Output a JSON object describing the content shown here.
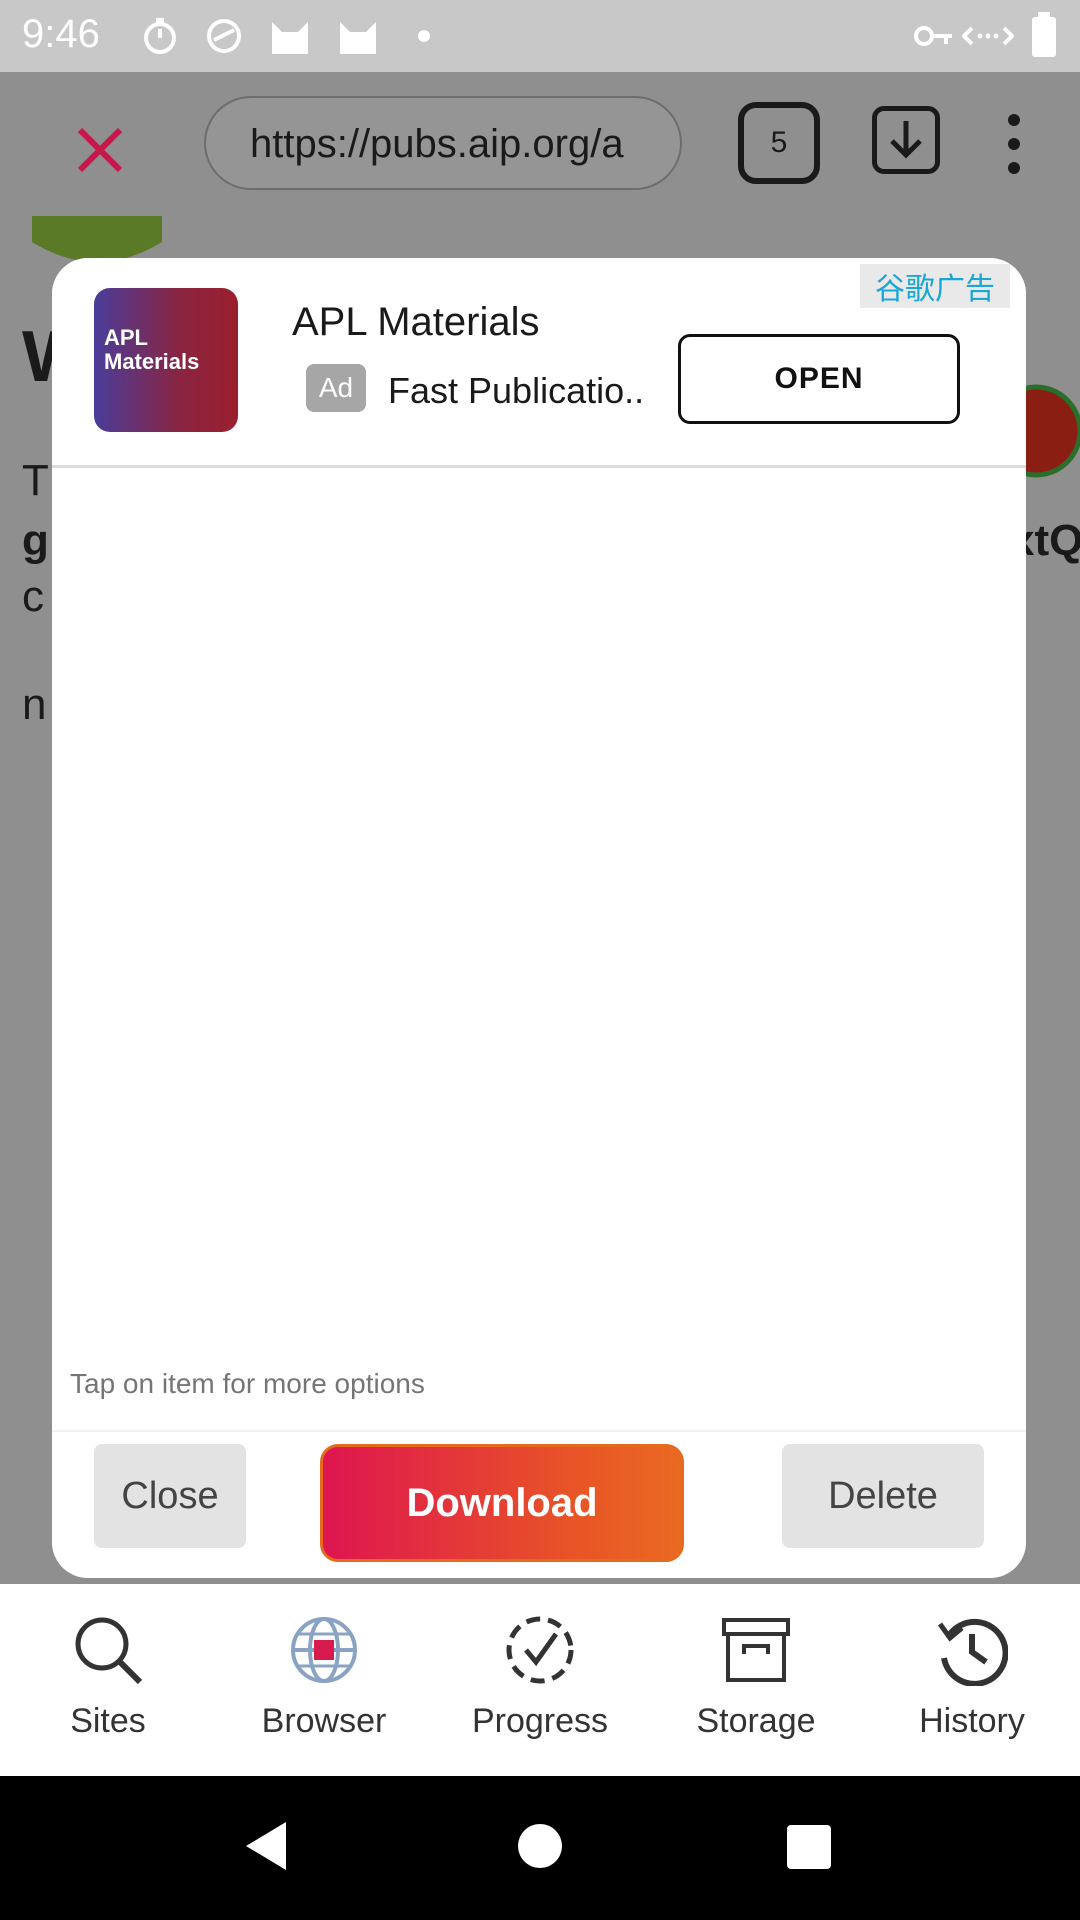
{
  "status_bar": {
    "time": "9:46",
    "icons": [
      "timer-icon",
      "speed-icon",
      "cat-icon",
      "cat-icon",
      "dot-icon",
      "vpn-key-icon",
      "data-icon",
      "battery-icon"
    ]
  },
  "toolbar": {
    "url": "https://pubs.aip.org/a",
    "tab_count": "5"
  },
  "webpage": {
    "fragments": [
      "W",
      "T",
      "g",
      "c",
      "n",
      "xtQ"
    ]
  },
  "ad": {
    "badge_cn": "谷歌广告",
    "logo_line1": "APL",
    "logo_line2": "Materials",
    "title": "APL Materials",
    "tag": "Ad",
    "subtitle": "Fast Publicatio..",
    "open_label": "OPEN"
  },
  "dialog": {
    "hint": "Tap on item for more options",
    "close_label": "Close",
    "download_label": "Download",
    "delete_label": "Delete"
  },
  "bottom_nav": {
    "items": [
      {
        "label": "Sites",
        "icon": "search-icon"
      },
      {
        "label": "Browser",
        "icon": "globe-icon"
      },
      {
        "label": "Progress",
        "icon": "progress-check-icon"
      },
      {
        "label": "Storage",
        "icon": "archive-box-icon"
      },
      {
        "label": "History",
        "icon": "history-icon"
      }
    ]
  },
  "colors": {
    "accent_start": "#de1550",
    "accent_end": "#ea6a22",
    "close_x": "#c8174a",
    "ad_badge": "#1aa6d6"
  }
}
